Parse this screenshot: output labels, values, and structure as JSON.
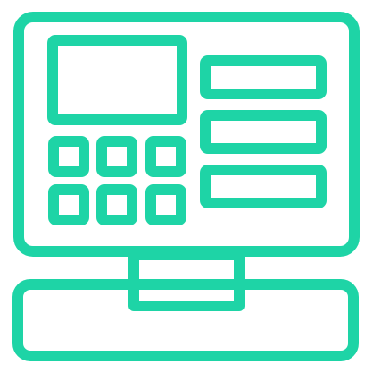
{
  "icon": {
    "name": "cash-register-icon",
    "stroke_color": "#1ED4A6",
    "background_color": "#FFFFFF",
    "keypad": {
      "rows": 2,
      "cols": 3
    },
    "side_panel_lines": 3
  }
}
